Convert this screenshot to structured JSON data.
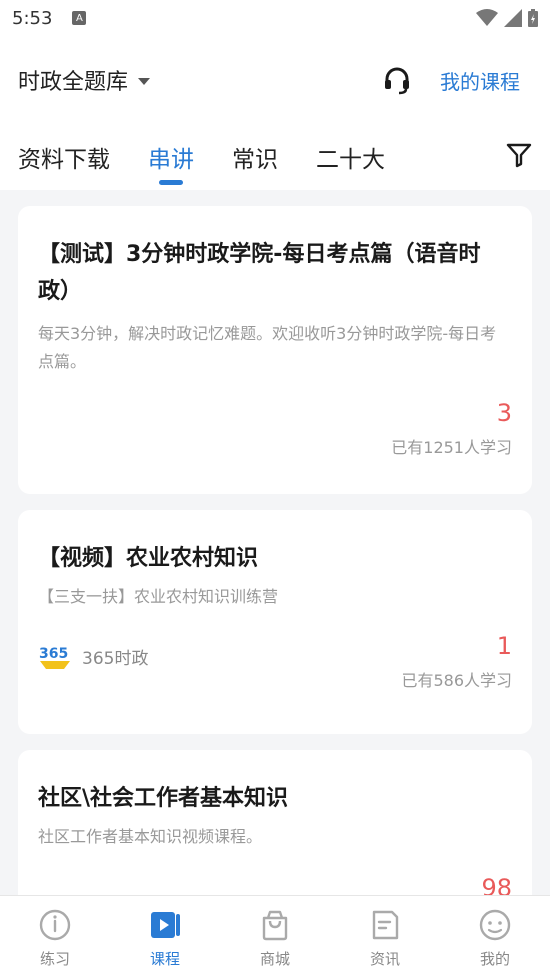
{
  "status": {
    "time": "5:53",
    "a_badge": "A"
  },
  "header": {
    "bank_title": "时政全题库",
    "my_course": "我的课程",
    "tabs": [
      {
        "label": "资料下载",
        "active": false
      },
      {
        "label": "串讲",
        "active": true
      },
      {
        "label": "常识",
        "active": false
      },
      {
        "label": "二十大",
        "active": false
      }
    ]
  },
  "cards": [
    {
      "title": "【测试】3分钟时政学院-每日考点篇（语音时政）",
      "desc": "每天3分钟，解决时政记忆难题。欢迎收听3分钟时政学院-每日考点篇。",
      "count": "3",
      "learners": "已有1251人学习"
    },
    {
      "title": "【视频】农业农村知识",
      "desc": "【三支一扶】农业农村知识训练营",
      "publisher": "365时政",
      "count": "1",
      "learners": "已有586人学习"
    },
    {
      "title": "社区\\社会工作者基本知识",
      "desc": "社区工作者基本知识视频课程。",
      "count": "98"
    }
  ],
  "bottom_nav": [
    {
      "label": "练习",
      "icon": "practice-icon",
      "active": false
    },
    {
      "label": "课程",
      "icon": "course-icon",
      "active": true
    },
    {
      "label": "商城",
      "icon": "mall-icon",
      "active": false
    },
    {
      "label": "资讯",
      "icon": "news-icon",
      "active": false
    },
    {
      "label": "我的",
      "icon": "profile-icon",
      "active": false
    }
  ],
  "colors": {
    "accent": "#2a7bd4",
    "count": "#e95a5a",
    "muted": "#999999"
  }
}
